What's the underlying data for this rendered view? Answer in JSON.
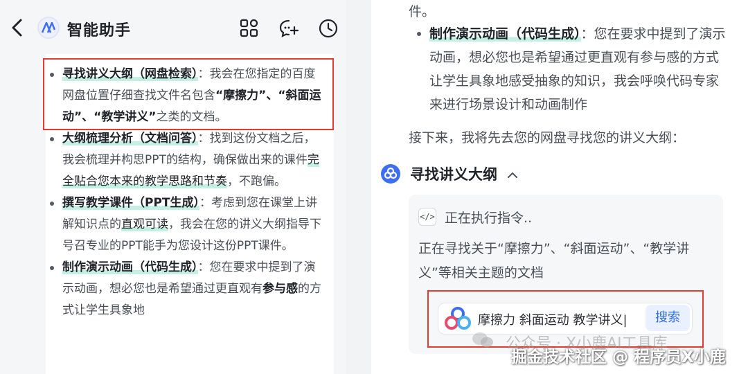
{
  "header": {
    "title": "智能助手"
  },
  "left_items": [
    {
      "head": "寻找讲义大纲（网盘检索）",
      "sep": "：",
      "pre": "我会在您指定的百度网盘位置仔细查找文件名包含",
      "q1": "“摩擦力”、“斜面运动”、“教学讲义”",
      "post": "之类的文档。"
    },
    {
      "head": "大纲梳理分析（文档问答）",
      "sep": "：",
      "pre": "找到这份文档之后，我会梳理并构思PPT的结构，确保做出来的课件",
      "em": "完全贴合您本来的教学思路和节奏",
      "post": "，不跑偏。"
    },
    {
      "head": "撰写教学课件（PPT生成）",
      "sep": "：",
      "pre": "考虑到您在课堂上讲解知识点的",
      "em": "直观可读",
      "post": "，我会在您的讲义大纲指导下号召专业的PPT能手为您设计这份PPT课件。"
    },
    {
      "head": "制作演示动画（代码生成）",
      "sep": "：",
      "pre": "您在要求中提到了演示动画，想必您也是希望通过更直观有",
      "em": "参与感",
      "post": "的方式让学生具象地"
    }
  ],
  "right": {
    "top_fragment": "件。",
    "item_head": "制作演示动画（代码生成）",
    "item_sep": "：",
    "item_text": "您在要求中提到了演示动画，想必您也是希望通过更直观有参与感的方式让学生具象地感受抽象的知识，我会呼唤代码专家来进行场景设计和动画制作",
    "next_text": "接下来，我将先去您的网盘寻找您的讲义大纲：",
    "step_title": "寻找讲义大纲",
    "exec_label": "正在执行指令..",
    "exec_desc": "正在寻找关于“摩擦力”、“斜面运动”、“教学讲义”等相关主题的文档",
    "search_query": "摩擦力 斜面运动 教学讲义|",
    "search_button": "搜索"
  },
  "watermark": {
    "line1": "公众号 · X小鹿AI工具库",
    "line2": "掘金技术社区 @ 程序员X小鹿"
  },
  "colors": {
    "highlight": "#c4f0e3",
    "red_box": "#e23b30",
    "accent": "#3e6ff2"
  }
}
